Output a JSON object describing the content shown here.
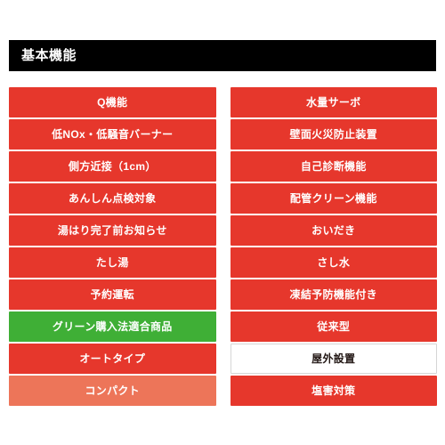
{
  "header": {
    "title": "基本機能"
  },
  "columns": [
    {
      "name": "left",
      "items": [
        {
          "label": "Q機能",
          "state": "red"
        },
        {
          "label": "低NOx・低騒音バーナー",
          "state": "red"
        },
        {
          "label": "側方近接（1cm）",
          "state": "red"
        },
        {
          "label": "あんしん点検対象",
          "state": "red"
        },
        {
          "label": "湯はり完了前お知らせ",
          "state": "red"
        },
        {
          "label": "たし湯",
          "state": "red"
        },
        {
          "label": "予約運転",
          "state": "red"
        },
        {
          "label": "グリーン購入法適合商品",
          "state": "green"
        },
        {
          "label": "オートタイプ",
          "state": "red"
        },
        {
          "label": "コンパクト",
          "state": "salmon"
        }
      ]
    },
    {
      "name": "right",
      "items": [
        {
          "label": "水量サーボ",
          "state": "red"
        },
        {
          "label": "壁面火災防止装置",
          "state": "red"
        },
        {
          "label": "自己診断機能",
          "state": "red"
        },
        {
          "label": "配管クリーン機能",
          "state": "red"
        },
        {
          "label": "おいだき",
          "state": "red"
        },
        {
          "label": "さし水",
          "state": "red"
        },
        {
          "label": "凍結予防機能付き",
          "state": "red"
        },
        {
          "label": "従来型",
          "state": "red"
        },
        {
          "label": "屋外設置",
          "state": "white"
        },
        {
          "label": "塩害対策",
          "state": "red"
        }
      ]
    }
  ],
  "colors": {
    "red": "#e6372c",
    "green": "#3faf36",
    "salmon": "#ed7559",
    "white": "#ffffff",
    "header_background": "#000000",
    "header_text": "#ffffff",
    "white_item_text": "#231815",
    "white_item_border": "#d6d6d6",
    "page_background": "#ffffff"
  }
}
